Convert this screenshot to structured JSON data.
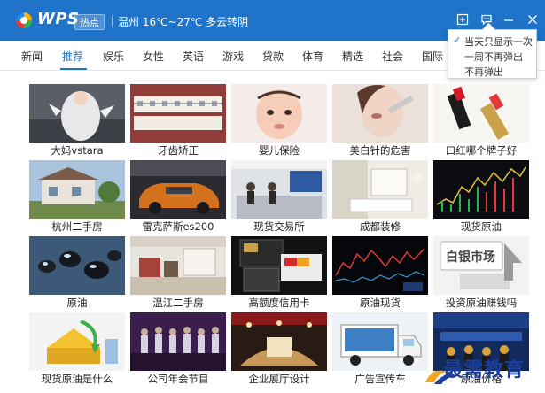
{
  "titlebar": {
    "brand": "WPS",
    "hot_tag": "热点",
    "weather": "温州 16℃~27℃ 多云转阴",
    "controls": [
      "expand-icon",
      "feedback-icon",
      "minimize-icon",
      "close-icon"
    ]
  },
  "tabs": [
    {
      "label": "新闻"
    },
    {
      "label": "推荐"
    },
    {
      "label": "娱乐"
    },
    {
      "label": "女性"
    },
    {
      "label": "英语"
    },
    {
      "label": "游戏"
    },
    {
      "label": "贷款"
    },
    {
      "label": "体育"
    },
    {
      "label": "精选"
    },
    {
      "label": "社会"
    },
    {
      "label": "国际"
    }
  ],
  "active_tab": "推荐",
  "dropdown": {
    "items": [
      {
        "label": "当天只显示一次",
        "checked": true
      },
      {
        "label": "一周不再弹出",
        "checked": false
      },
      {
        "label": "不再弹出",
        "checked": false
      }
    ]
  },
  "grid": {
    "items": [
      {
        "caption": "大妈vstara"
      },
      {
        "caption": "牙齿矫正"
      },
      {
        "caption": "婴儿保险"
      },
      {
        "caption": "美白针的危害"
      },
      {
        "caption": "口红哪个牌子好"
      },
      {
        "caption": "杭州二手房"
      },
      {
        "caption": "雷克萨斯es200"
      },
      {
        "caption": "现货交易所"
      },
      {
        "caption": "成都装修"
      },
      {
        "caption": "现货原油"
      },
      {
        "caption": "原油"
      },
      {
        "caption": "温江二手房"
      },
      {
        "caption": "高额度信用卡"
      },
      {
        "caption": "原油现货"
      },
      {
        "caption": "投资原油赚钱吗"
      },
      {
        "caption": "现货原油是什么"
      },
      {
        "caption": "公司年会节目"
      },
      {
        "caption": "企业展厅设计"
      },
      {
        "caption": "广告宣传车"
      },
      {
        "caption": "原油价格"
      }
    ]
  },
  "watermark": {
    "text": "最需教育"
  },
  "colors": {
    "accent": "#1f74c9",
    "titlebar_bg": "#1f74c9",
    "watermark": "#1a3e9c"
  }
}
